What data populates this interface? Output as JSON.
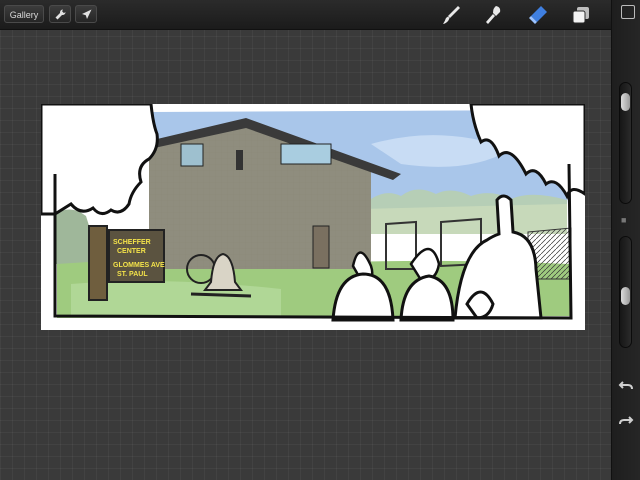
{
  "toolbar": {
    "gallery_label": "Gallery",
    "left_icons": [
      "wrench-icon",
      "cursor-icon"
    ],
    "tools": [
      "brush-icon",
      "smudge-icon",
      "eraser-icon",
      "layers-icon"
    ],
    "active_tool": "eraser-icon",
    "active_color": "#3f7fe0"
  },
  "sidebar": {
    "icons": [
      "color-square-icon",
      "undo-icon",
      "redo-icon"
    ]
  },
  "artwork": {
    "sign_lines": [
      "SCHEFFER",
      "CENTER",
      "GLOMMES AVE",
      "ST. PAUL"
    ]
  }
}
